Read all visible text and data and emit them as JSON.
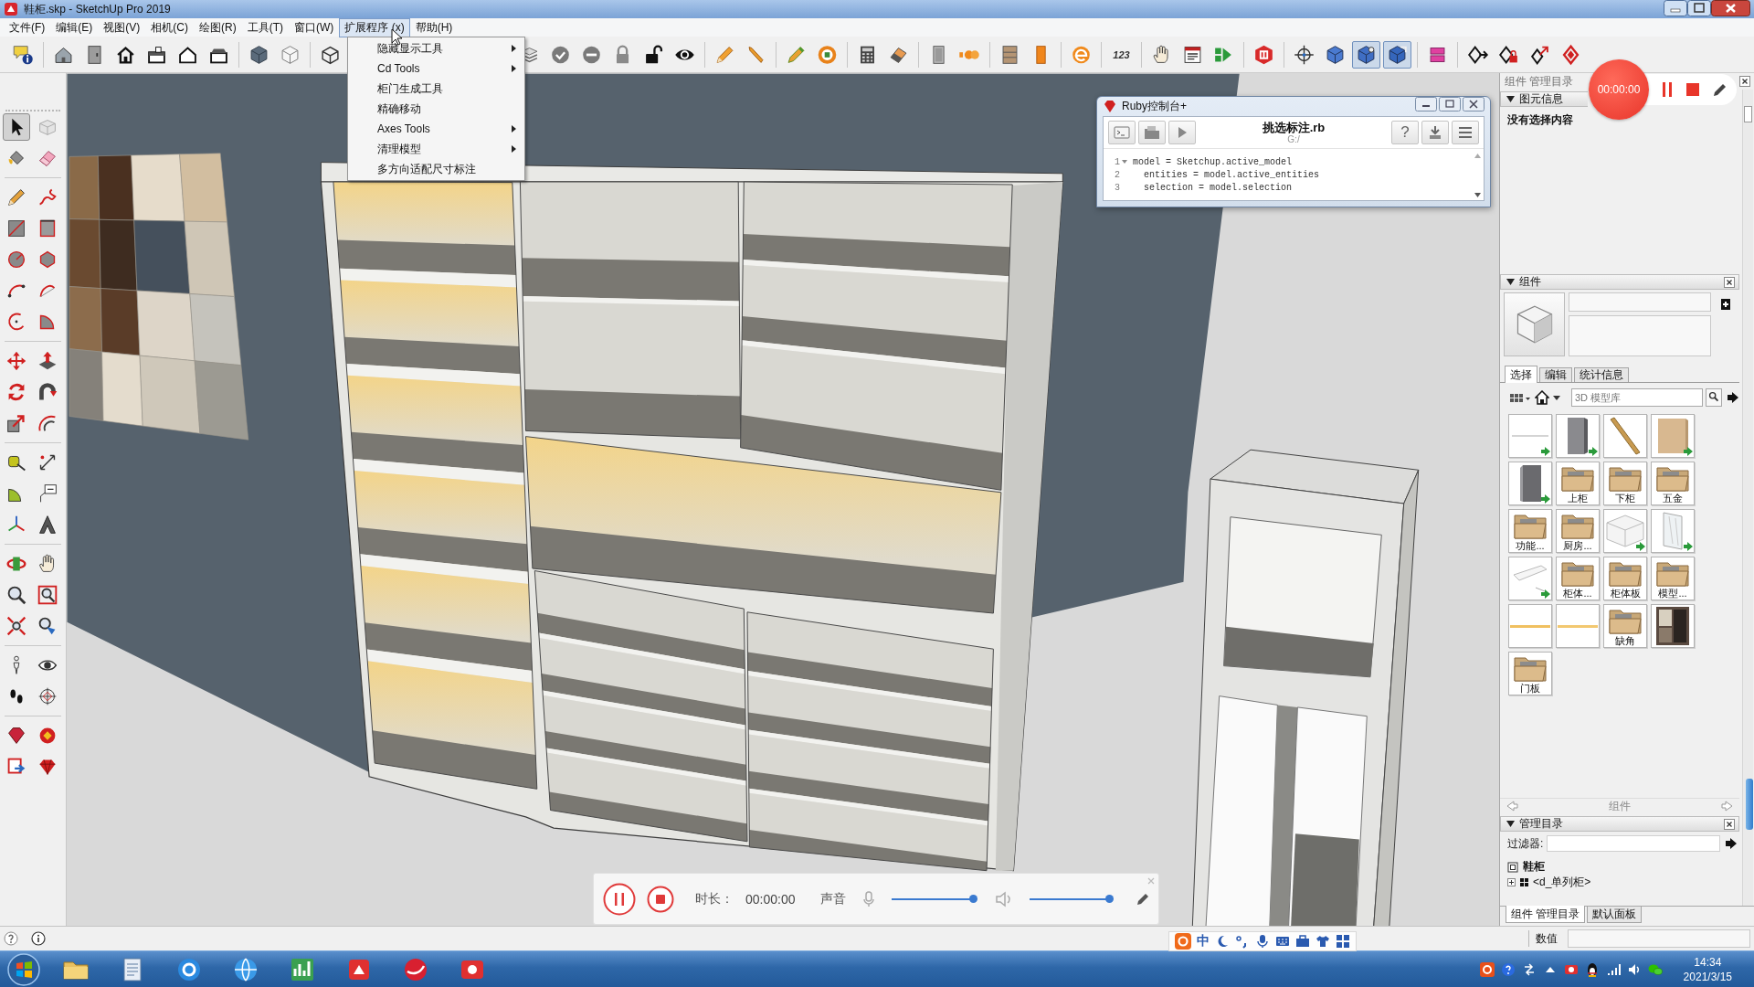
{
  "window": {
    "title": "鞋柜.skp - SketchUp Pro 2019"
  },
  "menu_bar": {
    "items": [
      {
        "label": "文件(F)",
        "selected": false
      },
      {
        "label": "编辑(E)",
        "selected": false
      },
      {
        "label": "视图(V)",
        "selected": false
      },
      {
        "label": "相机(C)",
        "selected": false
      },
      {
        "label": "绘图(R)",
        "selected": false
      },
      {
        "label": "工具(T)",
        "selected": false
      },
      {
        "label": "窗口(W)",
        "selected": false
      },
      {
        "label": "扩展程序 (x)",
        "selected": true
      },
      {
        "label": "帮助(H)",
        "selected": false
      }
    ]
  },
  "extensions_menu": {
    "items": [
      {
        "label": "隐藏显示工具",
        "submenu": true
      },
      {
        "label": "Cd Tools",
        "submenu": true
      },
      {
        "label": "柜门生成工具",
        "submenu": false
      },
      {
        "label": "精确移动",
        "submenu": false
      },
      {
        "label": "Axes Tools",
        "submenu": true
      },
      {
        "label": "清理模型",
        "submenu": true
      },
      {
        "label": "多方向适配尺寸标注",
        "submenu": false
      }
    ]
  },
  "toolbar": {
    "buttons": [
      {
        "pressed": false
      },
      {
        "pressed": false
      },
      {
        "pressed": false
      },
      {
        "pressed": false
      },
      {
        "pressed": false
      },
      {
        "pressed": false
      },
      {
        "pressed": false
      },
      {
        "pressed": false
      },
      {
        "pressed": false
      },
      {
        "pressed": false
      },
      {
        "pressed": false
      },
      {
        "pressed": false
      },
      {
        "pressed": false
      },
      {
        "pressed": false
      },
      {
        "pressed": false
      },
      {
        "pressed": false
      },
      {
        "pressed": false
      },
      {
        "pressed": false
      },
      {
        "pressed": false
      },
      {
        "pressed": false
      },
      {
        "pressed": false
      },
      {
        "pressed": false
      },
      {
        "pressed": false
      },
      {
        "pressed": false
      },
      {
        "pressed": false
      },
      {
        "pressed": false
      },
      {
        "pressed": false
      },
      {
        "label": "123",
        "pressed": false
      },
      {
        "pressed": false
      },
      {
        "pressed": false
      },
      {
        "pressed": false
      },
      {
        "pressed": false
      },
      {
        "pressed": false
      },
      {
        "pressed": false
      },
      {
        "pressed": true
      },
      {
        "pressed": true
      },
      {
        "pressed": false
      },
      {
        "pressed": false
      },
      {
        "pressed": false
      },
      {
        "pressed": false
      },
      {
        "pressed": false
      }
    ]
  },
  "tools": {
    "items": [
      {
        "selected": true
      },
      {
        "selected": false
      },
      {
        "selected": false
      },
      {
        "selected": false
      },
      {
        "selected": false
      },
      {
        "selected": false
      },
      {
        "selected": false
      },
      {
        "selected": false
      },
      {
        "selected": false
      },
      {
        "selected": false
      },
      {
        "selected": false
      },
      {
        "selected": false
      },
      {
        "selected": false
      },
      {
        "selected": false
      },
      {
        "selected": false
      },
      {
        "selected": false
      },
      {
        "selected": false
      },
      {
        "selected": false
      },
      {
        "selected": false
      },
      {
        "selected": false
      },
      {
        "selected": false
      },
      {
        "selected": false
      },
      {
        "selected": false
      },
      {
        "selected": false
      },
      {
        "selected": false
      },
      {
        "selected": false
      },
      {
        "selected": false
      },
      {
        "selected": false
      },
      {
        "selected": false
      },
      {
        "selected": false
      },
      {
        "selected": false
      },
      {
        "selected": false
      },
      {
        "selected": false
      },
      {
        "selected": false
      },
      {
        "selected": false
      },
      {
        "selected": false
      },
      {
        "selected": false
      },
      {
        "selected": false
      },
      {
        "selected": false
      },
      {
        "selected": false
      }
    ]
  },
  "ruby_console": {
    "title": "Ruby控制台+",
    "file_name": "挑选标注.rb",
    "path": "G:/",
    "help_button": "?",
    "code": [
      {
        "number": "1",
        "fold": true,
        "text": "model = Sketchup.active_model"
      },
      {
        "number": "2",
        "fold": false,
        "text": "  entities = model.active_entities"
      },
      {
        "number": "3",
        "fold": false,
        "text": "  selection = model.selection"
      }
    ]
  },
  "record_timer": {
    "time": "00:00:00"
  },
  "tray": {
    "title": "组件 管理目录",
    "entity_info": {
      "header": "图元信息",
      "expanded": true,
      "message": "没有选择内容"
    },
    "components": {
      "header": "组件",
      "expanded": true,
      "tabs": [
        {
          "label": "选择",
          "selected": true
        },
        {
          "label": "编辑",
          "selected": false
        },
        {
          "label": "统计信息",
          "selected": false
        }
      ],
      "search": {
        "placeholder": "3D 模型库"
      },
      "items": [
        {
          "kind": "model"
        },
        {
          "kind": "model"
        },
        {
          "kind": "model"
        },
        {
          "kind": "model"
        },
        {
          "kind": "model"
        },
        {
          "kind": "folder",
          "label": "上柜"
        },
        {
          "kind": "folder",
          "label": "下柜"
        },
        {
          "kind": "folder",
          "label": "五金"
        },
        {
          "kind": "folder",
          "label": "功能..."
        },
        {
          "kind": "folder",
          "label": "厨房..."
        },
        {
          "kind": "model"
        },
        {
          "kind": "model"
        },
        {
          "kind": "model"
        },
        {
          "kind": "folder",
          "label": "柜体..."
        },
        {
          "kind": "folder",
          "label": "柜体板"
        },
        {
          "kind": "folder",
          "label": "模型..."
        },
        {
          "kind": "model"
        },
        {
          "kind": "model"
        },
        {
          "kind": "folder",
          "label": "缺角"
        },
        {
          "kind": "model"
        },
        {
          "kind": "folder",
          "label": "门板"
        }
      ],
      "footer": "组件"
    },
    "outliner": {
      "header": "管理目录",
      "expanded": true,
      "filter_label": "过滤器:",
      "tree": [
        {
          "label": "鞋柜",
          "children": [
            {
              "label": "<d_单列柜>",
              "expanded": false
            }
          ]
        }
      ]
    },
    "bottom_tabs": [
      {
        "label": "组件 管理目录",
        "selected": true
      },
      {
        "label": "默认面板",
        "selected": false
      }
    ]
  },
  "recorder": {
    "duration_label": "时长：",
    "duration": "00:00:00",
    "sound_label": "声音",
    "microphone": {
      "level": 1
    },
    "speaker": {
      "level": 1
    }
  },
  "status_bar": {
    "measurements_label": "数值"
  },
  "ime_bar": {
    "mode": "中"
  },
  "taskbar": {
    "time": "14:34",
    "date": "2021/3/15"
  }
}
